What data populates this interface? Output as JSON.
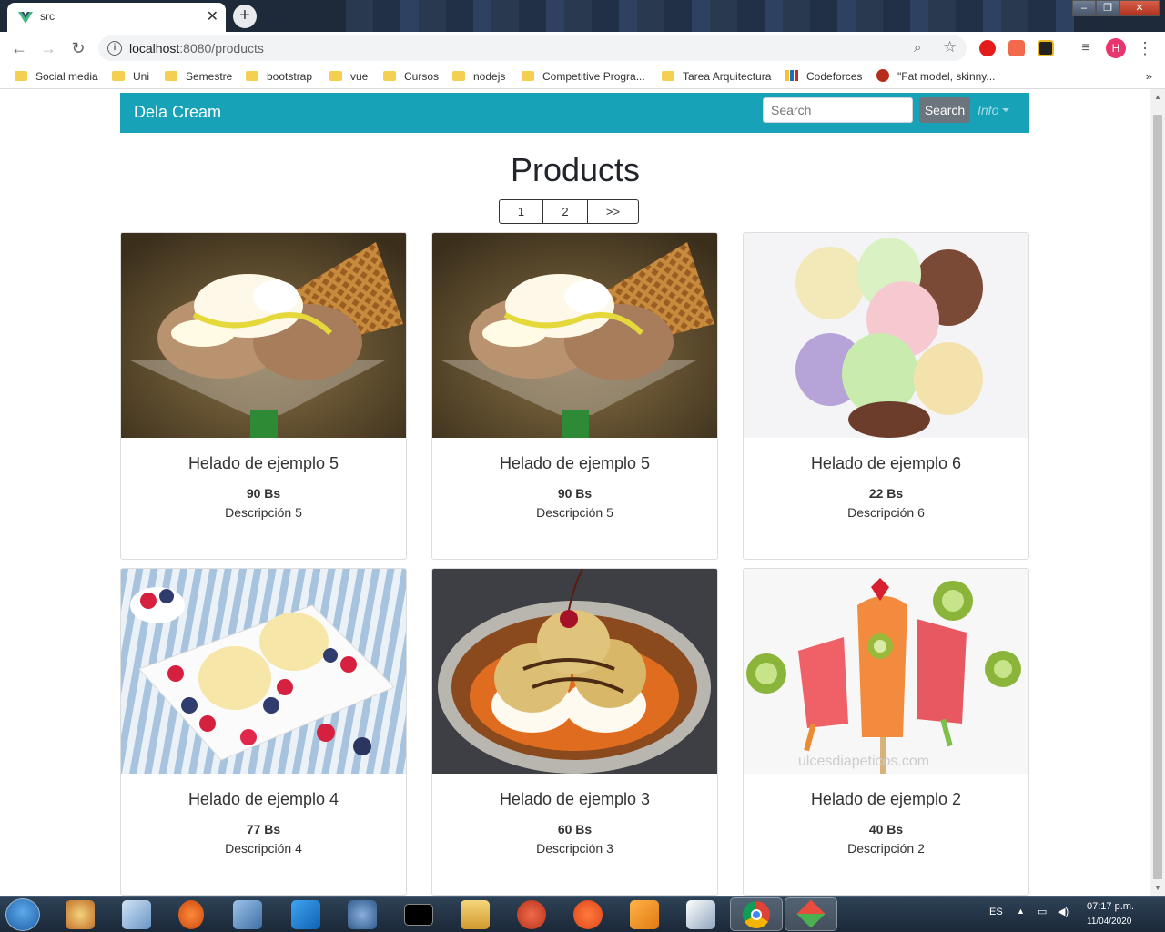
{
  "browser": {
    "tab_title": "src",
    "url_host": "localhost",
    "url_rest": ":8080/products",
    "profile_initial": "H",
    "bookmarks": [
      {
        "label": "Social media"
      },
      {
        "label": "Uni"
      },
      {
        "label": "Semestre"
      },
      {
        "label": "bootstrap"
      },
      {
        "label": "vue"
      },
      {
        "label": "Cursos"
      },
      {
        "label": "nodejs"
      },
      {
        "label": "Competitive Progra..."
      },
      {
        "label": "Tarea Arquitectura"
      },
      {
        "label": "Codeforces"
      },
      {
        "label": "\"Fat model, skinny..."
      }
    ],
    "more_bookmarks": "»"
  },
  "navbar": {
    "brand": "Dela Cream",
    "search_placeholder": "Search",
    "search_button": "Search",
    "info_label": "Info",
    "color": "#17a2b8"
  },
  "main": {
    "title": "Products",
    "pagination": [
      "1",
      "2",
      ">>"
    ],
    "products": [
      {
        "name": "Helado de ejemplo 5",
        "price": "90 Bs",
        "description": "Descripción 5",
        "image": "sundae-glass"
      },
      {
        "name": "Helado de ejemplo 5",
        "price": "90 Bs",
        "description": "Descripción 5",
        "image": "sundae-glass"
      },
      {
        "name": "Helado de ejemplo 6",
        "price": "22 Bs",
        "description": "Descripción 6",
        "image": "ice-cream-scoops"
      },
      {
        "name": "Helado de ejemplo 4",
        "price": "77 Bs",
        "description": "Descripción 4",
        "image": "berries-plate"
      },
      {
        "name": "Helado de ejemplo 3",
        "price": "60 Bs",
        "description": "Descripción 3",
        "image": "caramel-dessert"
      },
      {
        "name": "Helado de ejemplo 2",
        "price": "40 Bs",
        "description": "Descripción 2",
        "image": "fruit-popsicles"
      }
    ]
  },
  "taskbar": {
    "language": "ES",
    "time": "07:17 p.m.",
    "date": "11/04/2020"
  }
}
